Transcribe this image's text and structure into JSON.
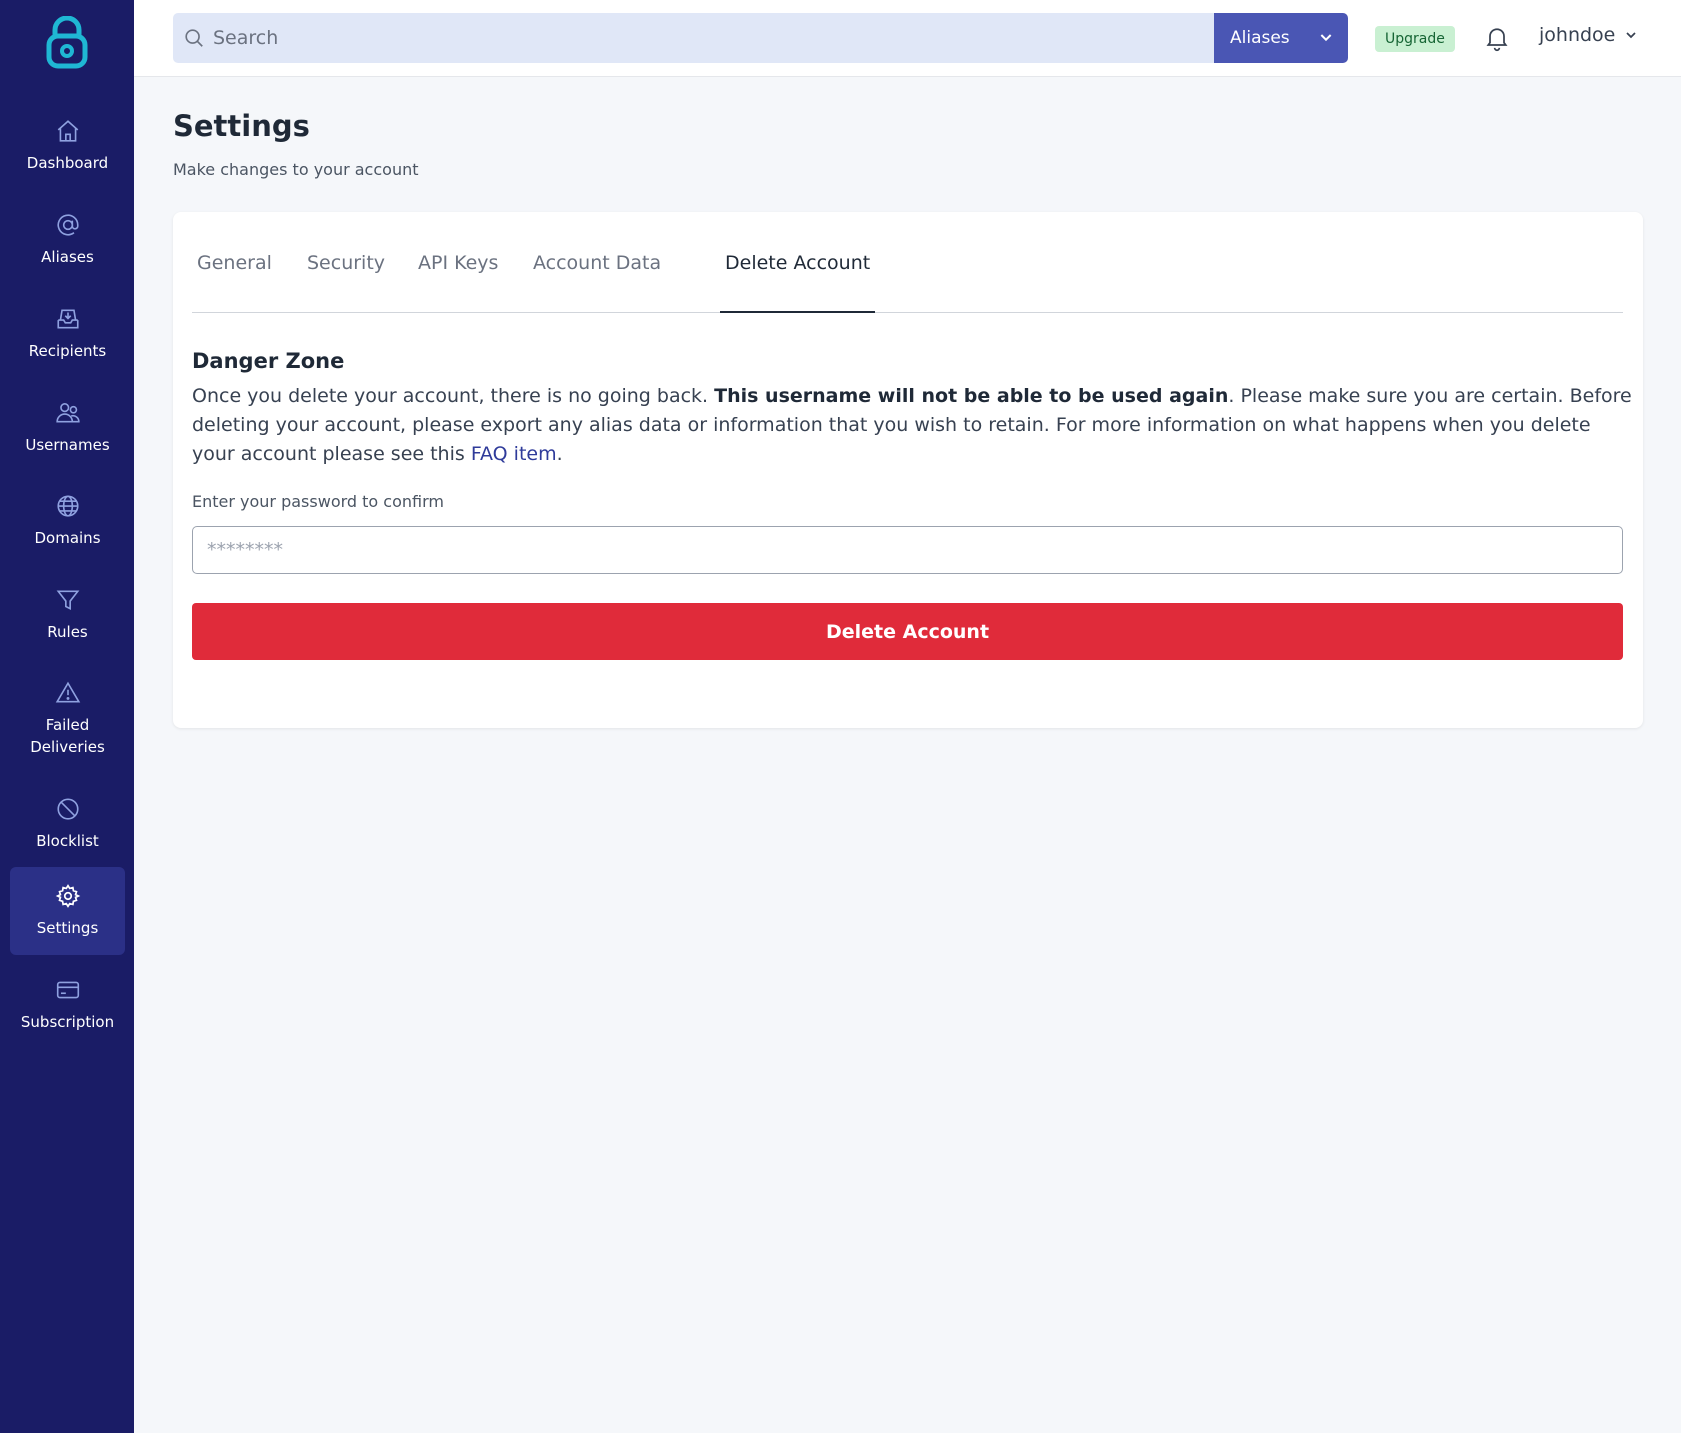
{
  "app": {
    "brand_color": "#1a1c66",
    "accent_color": "#4a56b4",
    "danger_color": "#e02b3a"
  },
  "sidebar": {
    "items": [
      {
        "label": "Dashboard",
        "icon": "home-icon"
      },
      {
        "label": "Aliases",
        "icon": "at-sign-icon"
      },
      {
        "label": "Recipients",
        "icon": "inbox-download-icon"
      },
      {
        "label": "Usernames",
        "icon": "users-icon"
      },
      {
        "label": "Domains",
        "icon": "globe-icon"
      },
      {
        "label": "Rules",
        "icon": "filter-icon"
      },
      {
        "label": "Failed Deliveries",
        "icon": "warning-triangle-icon"
      },
      {
        "label": "Blocklist",
        "icon": "ban-icon"
      },
      {
        "label": "Settings",
        "icon": "gear-icon",
        "active": true
      },
      {
        "label": "Subscription",
        "icon": "credit-card-icon"
      }
    ]
  },
  "header": {
    "search_placeholder": "Search",
    "search_scope": "Aliases",
    "upgrade_label": "Upgrade",
    "username": "johndoe"
  },
  "page": {
    "title": "Settings",
    "subtitle": "Make changes to your account"
  },
  "tabs": [
    "General",
    "Security",
    "API Keys",
    "Account Data",
    "Delete Account"
  ],
  "active_tab": "Delete Account",
  "danger_zone": {
    "title": "Danger Zone",
    "text_before": "Once you delete your account, there is no going back. ",
    "text_bold": "This username will not be able to be used again",
    "text_after": ". Please make sure you are certain. Before deleting your account, please export any alias data or information that you wish to retain. For more information on what happens when you delete your account please see this ",
    "link_text": "FAQ item",
    "text_end": ".",
    "password_label": "Enter your password to confirm",
    "password_placeholder": "********",
    "button_label": "Delete Account"
  }
}
